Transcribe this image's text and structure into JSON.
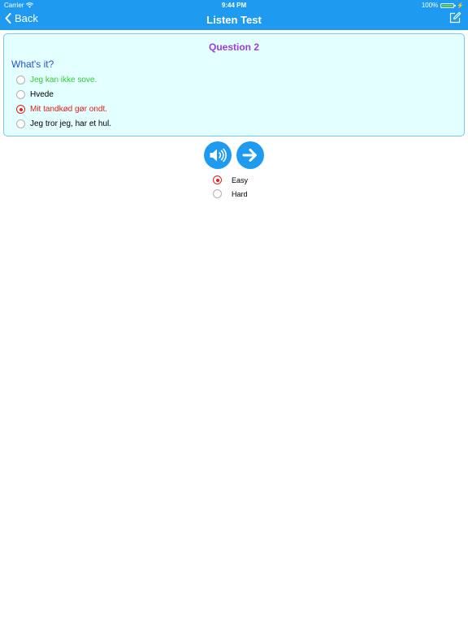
{
  "status_bar": {
    "carrier": "Carrier",
    "time": "9:44 PM",
    "battery": "100%"
  },
  "nav": {
    "back_label": "Back",
    "title": "Listen Test"
  },
  "question": {
    "title": "Question 2",
    "prompt": "What's it?",
    "options": [
      {
        "label": "Jeg kan ikke sove.",
        "color": "#2ecc2e",
        "selected": false
      },
      {
        "label": "Hvede",
        "color": "#000000",
        "selected": false
      },
      {
        "label": "Mit tandkød gør ondt.",
        "color": "#e2211c",
        "selected": true
      },
      {
        "label": "Jeg tror jeg, har et hul.",
        "color": "#000000",
        "selected": false
      }
    ]
  },
  "controls": {
    "play_icon": "speaker-icon",
    "next_icon": "arrow-right-icon"
  },
  "difficulty": {
    "options": [
      {
        "label": "Easy",
        "selected": true
      },
      {
        "label": "Hard",
        "selected": false
      }
    ]
  },
  "colors": {
    "accent": "#1e9bf0",
    "card_background": "#e4ffff",
    "question_title": "#9c3cdc",
    "prompt": "#2050d8",
    "selected_radio": "#e2211c"
  }
}
